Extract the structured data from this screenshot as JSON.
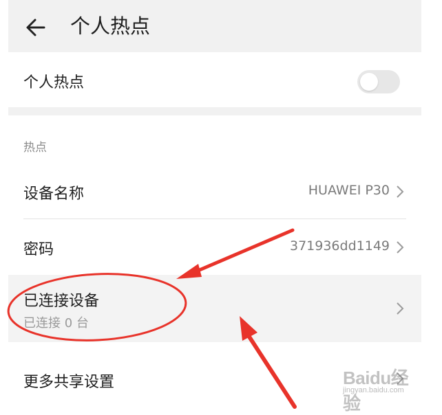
{
  "header": {
    "title": "个人热点",
    "back_icon": "back-arrow-icon"
  },
  "hotspot_toggle": {
    "label": "个人热点",
    "enabled": false
  },
  "section": {
    "label": "热点"
  },
  "rows": [
    {
      "label": "设备名称",
      "value": "HUAWEI P30"
    },
    {
      "label": "密码",
      "value": "371936dd1149"
    },
    {
      "label": "已连接设备",
      "subtitle": "已连接 0 台",
      "value": ""
    },
    {
      "label": "更多共享设置",
      "value": ""
    }
  ],
  "annotation": {
    "circle_color": "#e8332a",
    "arrow_color": "#e8332a"
  },
  "watermark": {
    "text": "Baidu经验",
    "url": "jingyan.baidu.com"
  }
}
